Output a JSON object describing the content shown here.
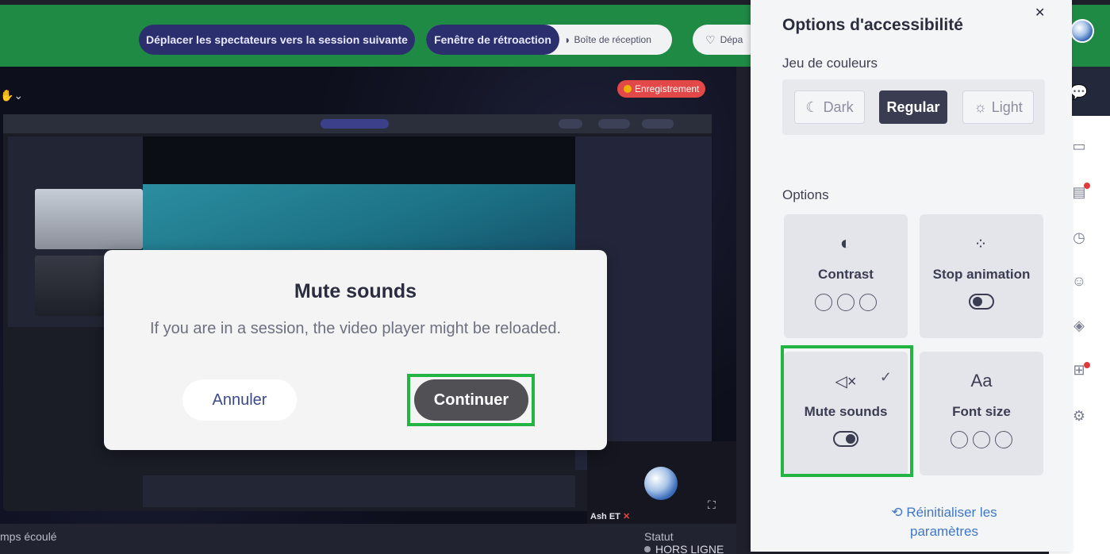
{
  "topbar": {
    "move_viewers": "Déplacer les spectateurs vers la session suivante",
    "feedback_window": "Fenêtre de rétroaction",
    "inbox": "Boîte de réception",
    "depart": "Dépa"
  },
  "stage": {
    "recording_label": "Enregistrement",
    "self_name": "Ash ET",
    "elapsed_label": "mps écoulé",
    "status_label": "Statut",
    "status_value": "HORS LIGNE"
  },
  "modal": {
    "title": "Mute sounds",
    "message": "If you are in a session, the video player might be reloaded.",
    "cancel_label": "Annuler",
    "continue_label": "Continuer"
  },
  "accessibility": {
    "title": "Options d'accessibilité",
    "color_scheme_label": "Jeu de couleurs",
    "schemes": [
      {
        "label": "Dark",
        "icon": "moon-icon",
        "active": false
      },
      {
        "label": "Regular",
        "icon": "",
        "active": true
      },
      {
        "label": "Light",
        "icon": "sun-icon",
        "active": false
      }
    ],
    "options_label": "Options",
    "options": {
      "contrast": {
        "label": "Contrast",
        "icon": "contrast-icon"
      },
      "stop_animation": {
        "label": "Stop animation",
        "icon": "spinner-icon",
        "enabled": false
      },
      "mute_sounds": {
        "label": "Mute sounds",
        "icon": "speaker-mute-icon",
        "enabled": true,
        "checked": true
      },
      "font_size": {
        "label": "Font size",
        "icon": "font-size-icon",
        "icon_text": "Aa"
      }
    },
    "reset_label": "Réinitialiser les paramètres"
  },
  "colors": {
    "brand_green": "#1e8a44",
    "highlight_green": "#23b544",
    "nav_blue": "#2c2f6e",
    "recording_red": "#e24848"
  }
}
